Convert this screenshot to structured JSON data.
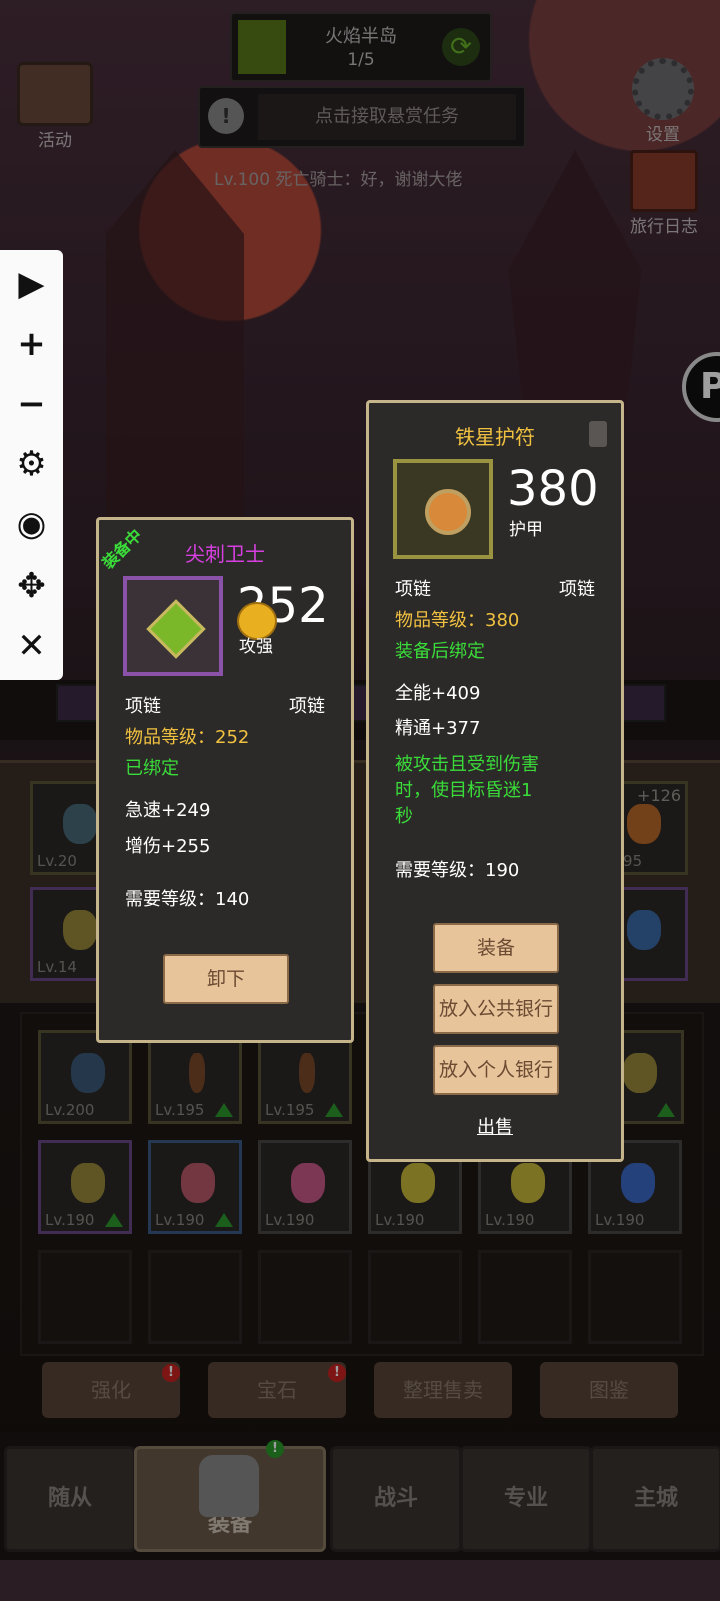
{
  "top": {
    "zone_name": "火焰半岛",
    "zone_progress": "1/5",
    "bounty_text": "点击接取悬赏任务",
    "chat_line": "Lv.100 死亡骑士：好，谢谢大佬",
    "activity_label": "活动",
    "settings_label": "设置",
    "journal_label": "旅行日志"
  },
  "equipped_item": {
    "status_ribbon": "装备中",
    "name": "尖刺卫士",
    "big_number": "252",
    "sub_label": "攻强",
    "slot_left": "项链",
    "slot_right": "项链",
    "item_level": "物品等级：252",
    "bind_status": "已绑定",
    "stats": [
      "急速+249",
      "增伤+255"
    ],
    "required_level": "需要等级：140",
    "unequip_label": "卸下"
  },
  "new_item": {
    "name": "铁星护符",
    "big_number": "380",
    "sub_label": "护甲",
    "slot_left": "项链",
    "slot_right": "项链",
    "item_level": "物品等级：380",
    "bind_status": "装备后绑定",
    "stats": [
      "全能+409",
      "精通+377"
    ],
    "effect": [
      "被攻击且受到伤害",
      "时，使目标昏迷1",
      "秒"
    ],
    "required_level": "需要等级：190",
    "actions": [
      "装备",
      "放入公共银行",
      "放入个人银行"
    ],
    "sell_label": "出售"
  },
  "equip_slots": [
    {
      "level": "Lv.20",
      "plus": "+"
    },
    {
      "level": "Lv.14",
      "plus": ""
    },
    {
      "level": "v.195",
      "plus": "+126"
    }
  ],
  "bag_items": [
    {
      "level": "Lv.200",
      "upgrade": false
    },
    {
      "level": "Lv.195",
      "upgrade": true
    },
    {
      "level": "Lv.195",
      "upgrade": true
    },
    {
      "level": "90",
      "upgrade": true
    },
    {
      "level": "Lv.190",
      "upgrade": true
    },
    {
      "level": "Lv.190",
      "upgrade": true
    },
    {
      "level": "Lv.190",
      "upgrade": false
    },
    {
      "level": "Lv.190",
      "upgrade": false
    },
    {
      "level": "Lv.190",
      "upgrade": false
    },
    {
      "level": "Lv.190",
      "upgrade": false
    }
  ],
  "action_buttons": [
    "强化",
    "宝石",
    "整理售卖",
    "图鉴"
  ],
  "nav_tabs": [
    "随从",
    "装备",
    "战斗",
    "专业",
    "主城"
  ],
  "notification_mark": "!",
  "toolbar_icons": [
    "play-icon",
    "plus-icon",
    "minus-icon",
    "gear-icon",
    "eye-icon",
    "move-icon",
    "close-icon"
  ],
  "colors": {
    "purple_name": "#d640e0",
    "gold_name": "#f0c040",
    "green_text": "#3adc3a",
    "panel_border": "#c6b58a"
  }
}
